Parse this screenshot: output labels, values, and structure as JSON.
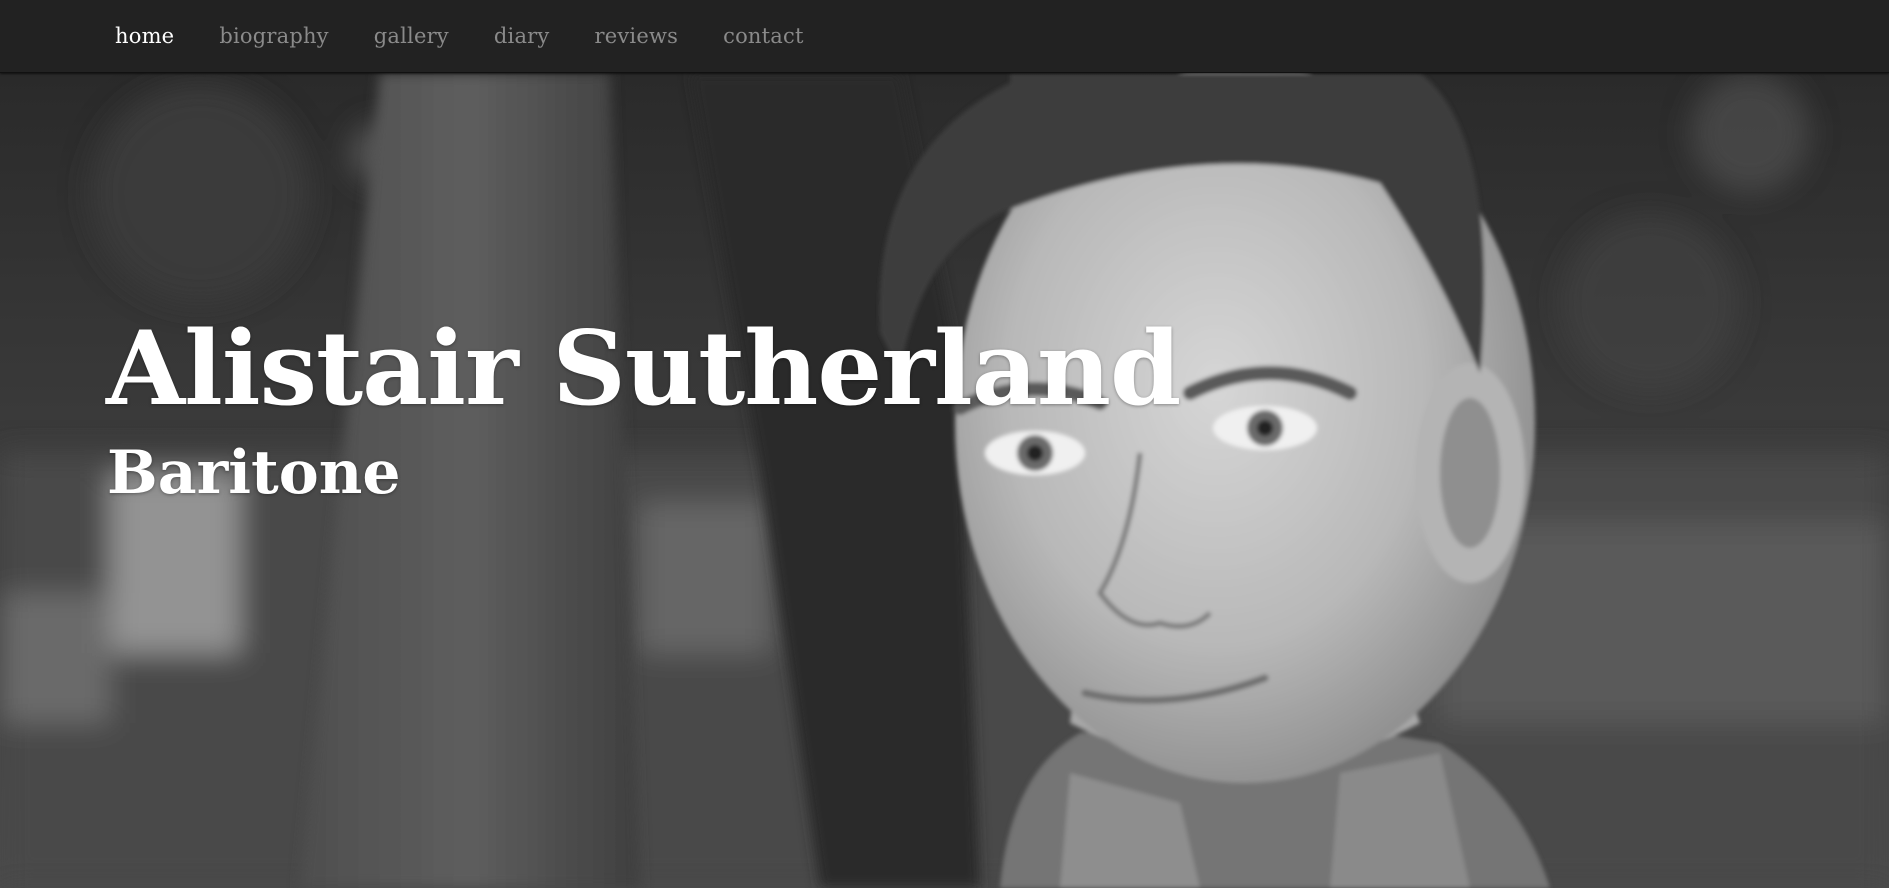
{
  "nav": {
    "items": [
      {
        "label": "home",
        "active": true
      },
      {
        "label": "biography",
        "active": false
      },
      {
        "label": "gallery",
        "active": false
      },
      {
        "label": "diary",
        "active": false
      },
      {
        "label": "reviews",
        "active": false
      },
      {
        "label": "contact",
        "active": false
      }
    ]
  },
  "hero": {
    "title": "Alistair Sutherland",
    "subtitle": "Baritone",
    "photo": "black-and-white portrait photo"
  },
  "colors": {
    "navbar_bg": "#222222",
    "nav_active": "#ffffff",
    "nav_inactive": "#8a8a8a",
    "hero_text": "#ffffff"
  }
}
